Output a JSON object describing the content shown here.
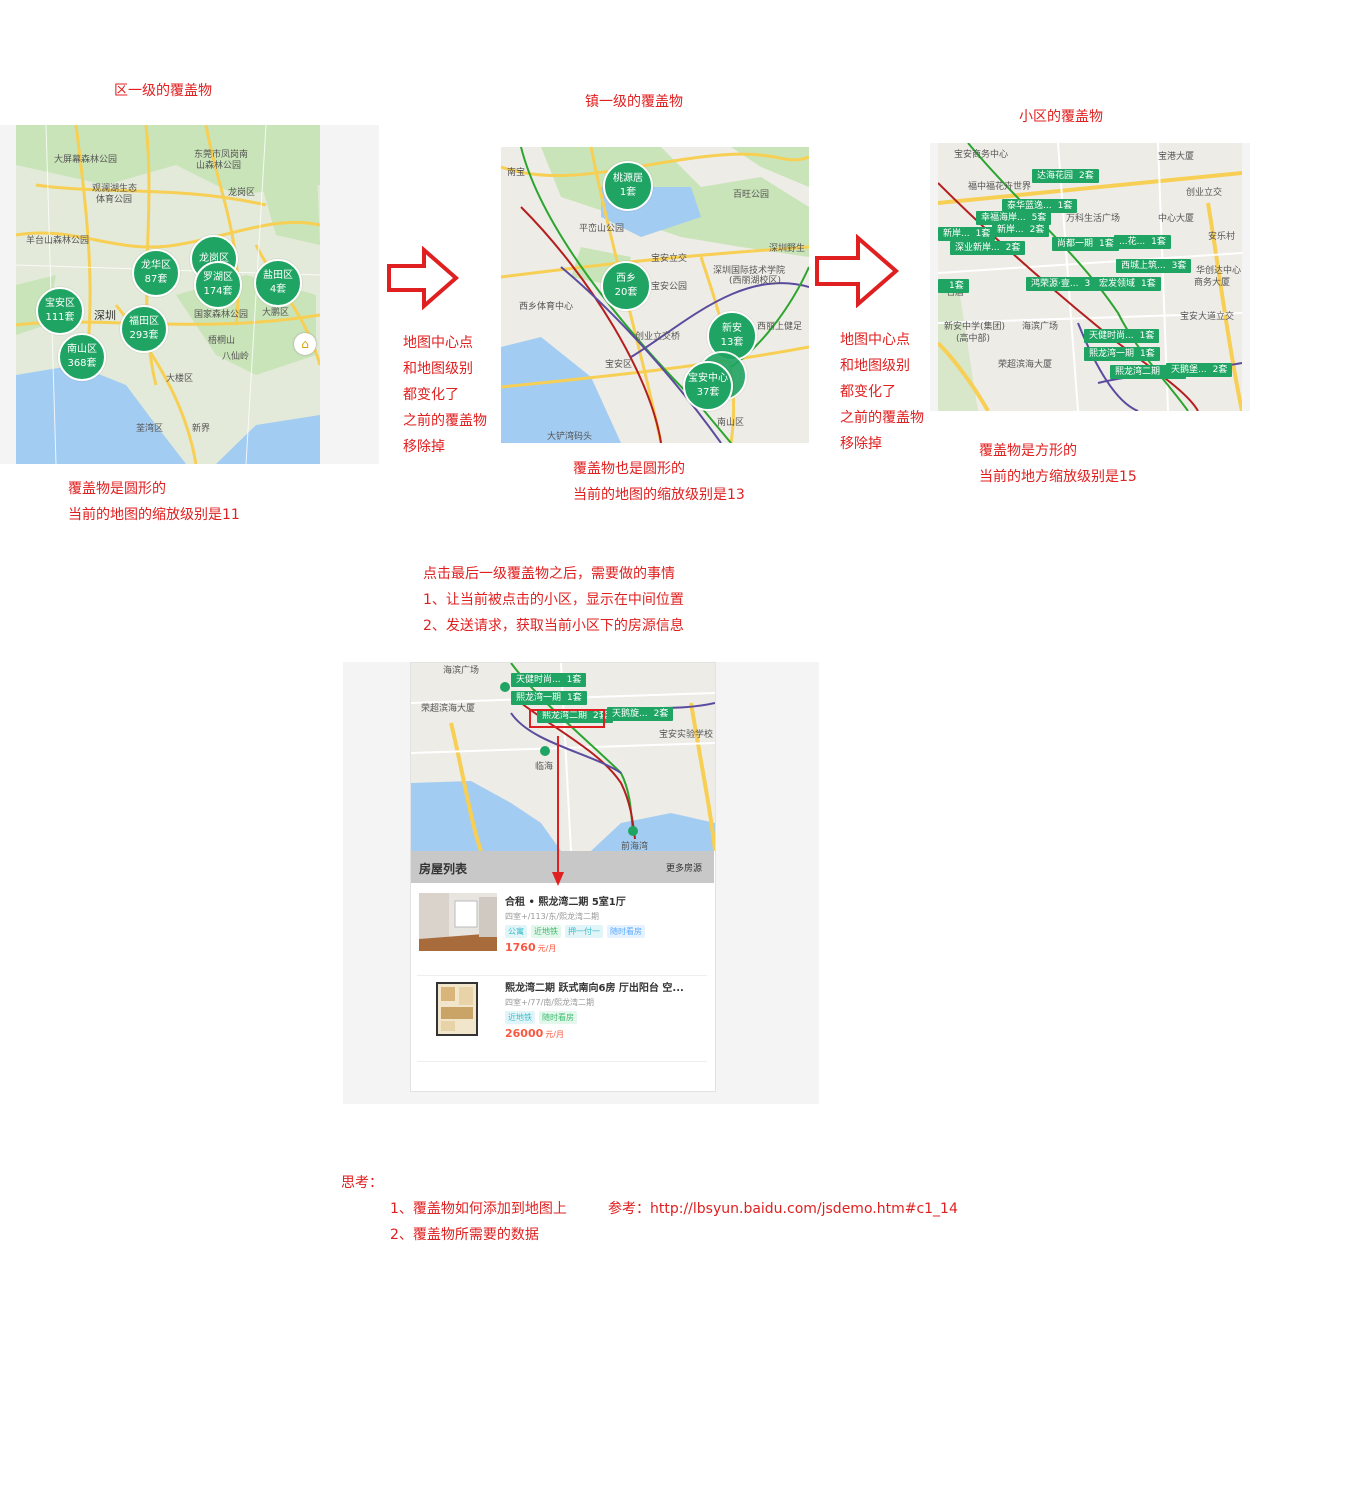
{
  "captions": {
    "district_title": "区一级的覆盖物",
    "town_title": "镇一级的覆盖物",
    "community_title": "小区的覆盖物"
  },
  "notes": {
    "map1_note": [
      "覆盖物是圆形的",
      "当前的地图的缩放级别是11"
    ],
    "arrow1_note": [
      "地图中心点",
      "和地图级别",
      "都变化了",
      "之前的覆盖物",
      "移除掉"
    ],
    "map2_note": [
      "覆盖物也是圆形的",
      "当前的地图的缩放级别是13"
    ],
    "arrow2_note": [
      "地图中心点",
      "和地图级别",
      "都变化了",
      "之前的覆盖物",
      "移除掉"
    ],
    "map3_note": [
      "覆盖物是方形的",
      "当前的地方缩放级别是15"
    ],
    "click_note": [
      "点击最后一级覆盖物之后，需要做的事情",
      "1、让当前被点击的小区，显示在中间位置",
      "2、发送请求，获取当前小区下的房源信息"
    ],
    "thinking_title": "思考：",
    "thinking_item1": "1、覆盖物如何添加到地图上",
    "thinking_ref": "参考：http://lbsyun.baidu.com/jsdemo.htm#c1_14",
    "thinking_item2": "2、覆盖物所需要的数据"
  },
  "map1": {
    "labels": [
      "观澜湖生态",
      "体育公园",
      "大屏幕森林公园",
      "东莞市凤岗南",
      "山森林公园",
      "龙岗区",
      "羊台山森林公园",
      "深圳",
      "大鹏区",
      "国家森林公园",
      "梧桐山",
      "八仙岭",
      "福田区",
      "大楼区",
      "荃湾区",
      "新界"
    ],
    "circles": [
      {
        "name": "龙华区",
        "count": "87套"
      },
      {
        "name": "龙岗区",
        "count": ""
      },
      {
        "name": "罗湖区",
        "count": "174套"
      },
      {
        "name": "盐田区",
        "count": "4套"
      },
      {
        "name": "宝安区",
        "count": "111套"
      },
      {
        "name": "福田区",
        "count": "293套"
      },
      {
        "name": "南山区",
        "count": "368套"
      }
    ]
  },
  "map2": {
    "labels": [
      "宝安立交",
      "平峦山公园",
      "深圳国际技术学院",
      "(西丽湖校区)",
      "宝安公园",
      "西乡体育中心",
      "创业立交桥",
      "宝安区",
      "西丽上健足",
      "南山区",
      "大铲湾码头",
      "百旺公园",
      "深圳野生"
    ],
    "circles": [
      {
        "name": "桃源居",
        "count": "1套"
      },
      {
        "name": "西乡",
        "count": "20套"
      },
      {
        "name": "新安",
        "count": "13套"
      },
      {
        "name": "宝安中心",
        "count": "37套"
      }
    ]
  },
  "map3": {
    "labels": [
      "宝安商务中心",
      "福中福花卉世界",
      "宝港大厦",
      "创业立交",
      "中心大厦",
      "安乐村",
      "万科生活广场",
      "华创达中心",
      "商务大厦",
      "新安中学(集团)",
      "(高中部)",
      "海滨广场",
      "荣超滨海大厦",
      "宝安大道立交",
      "名居"
    ],
    "tags": [
      {
        "name": "达海花园",
        "count": "2套"
      },
      {
        "name": "泰华蓝逸...",
        "count": "1套"
      },
      {
        "name": "幸福海岸...",
        "count": "5套"
      },
      {
        "name": "新岸...",
        "count": "1套"
      },
      {
        "name": "深业新岸...",
        "count": "2套"
      },
      {
        "name": "尚都一期",
        "count": "1套"
      },
      {
        "name": "...花...",
        "count": "1套"
      },
      {
        "name": "西城上筑...",
        "count": "3套"
      },
      {
        "name": "",
        "count": "1套"
      },
      {
        "name": "鸿荣源·壹...",
        "count": "3"
      },
      {
        "name": "宏发领域",
        "count": "1套"
      },
      {
        "name": "天健时尚...",
        "count": "1套"
      },
      {
        "name": "熙龙湾一期",
        "count": "1套"
      },
      {
        "name": "熙龙湾二期",
        "count": "2套"
      },
      {
        "name": "天鹅堡...",
        "count": "2套"
      }
    ]
  },
  "phone": {
    "map_labels": [
      "海滨广场",
      "荣超滨海大厦",
      "宝安实验学校",
      "临海",
      "前海湾",
      "宝安区",
      "宝安中学"
    ],
    "tags": [
      {
        "name": "天健时尚...",
        "count": "1套"
      },
      {
        "name": "熙龙湾一期",
        "count": "1套"
      },
      {
        "name": "熙龙湾二期",
        "count": "2套"
      },
      {
        "name": "天鹅旋...",
        "count": "2套"
      }
    ],
    "list_title": "房屋列表",
    "more_link": "更多房源",
    "items": [
      {
        "title": "合租 • 熙龙湾二期 5室1厅",
        "desc": "四室+/113/东/熙龙湾二期",
        "tags": [
          "公寓",
          "近地铁",
          "押一付一",
          "随时看房"
        ],
        "price": "1760",
        "unit": "元/月"
      },
      {
        "title": "熙龙湾二期 跃式南向6房 厅出阳台 空...",
        "desc": "四室+/77/南/熙龙湾二期",
        "tags": [
          "近地铁",
          "随时看房"
        ],
        "price": "26000",
        "unit": "元/月"
      }
    ]
  },
  "colors": {
    "accent": "#e02020",
    "marker": "#1fa463",
    "price": "#fa5741",
    "map_land": "#eceae3",
    "map_green": "#c9e4b8",
    "map_water": "#a3ccf2",
    "road_yellow": "#f7cf54"
  }
}
